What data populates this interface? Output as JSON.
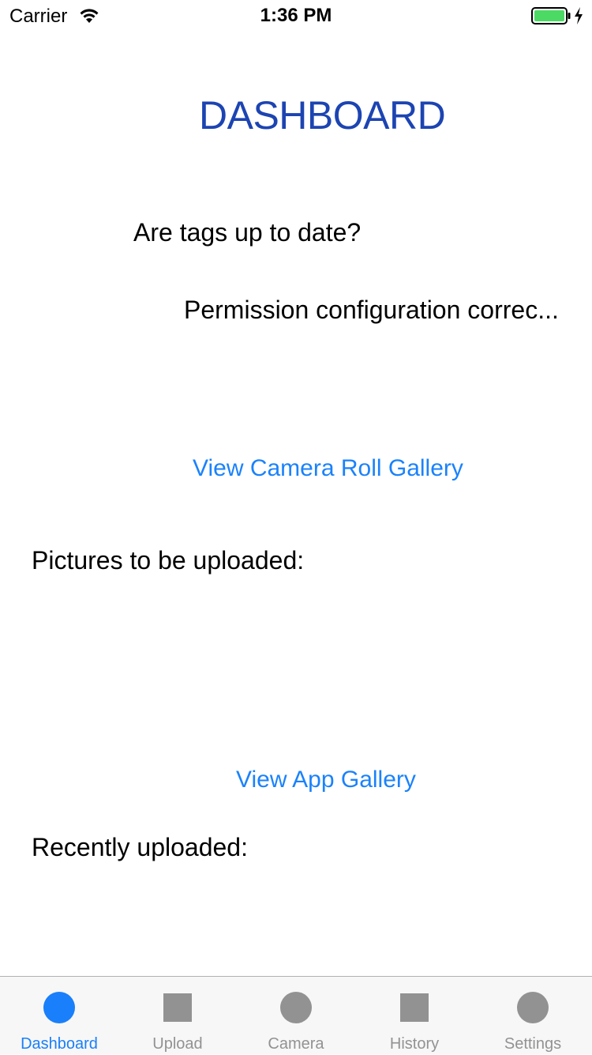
{
  "status_bar": {
    "carrier": "Carrier",
    "time": "1:36 PM",
    "wifi_icon": "wifi-icon",
    "battery_icon": "battery-icon",
    "charging_icon": "charging-bolt-icon",
    "battery_color": "#4cd964"
  },
  "main": {
    "title": "DASHBOARD",
    "title_color": "#1c44b2",
    "tags_status": "Are tags up to date?",
    "permission_status": "Permission configuration correc...",
    "camera_roll_link": "View Camera Roll Gallery",
    "pictures_label": "Pictures to be uploaded:",
    "app_gallery_link": "View App Gallery",
    "recent_label": "Recently uploaded:",
    "link_color": "#1a82fb"
  },
  "tab_bar": {
    "active_color": "#1a7ffa",
    "inactive_color": "#929292",
    "tabs": [
      {
        "label": "Dashboard",
        "icon": "circle-icon",
        "active": true
      },
      {
        "label": "Upload",
        "icon": "square-icon",
        "active": false
      },
      {
        "label": "Camera",
        "icon": "circle-icon",
        "active": false
      },
      {
        "label": "History",
        "icon": "square-icon",
        "active": false
      },
      {
        "label": "Settings",
        "icon": "circle-icon",
        "active": false
      }
    ]
  }
}
